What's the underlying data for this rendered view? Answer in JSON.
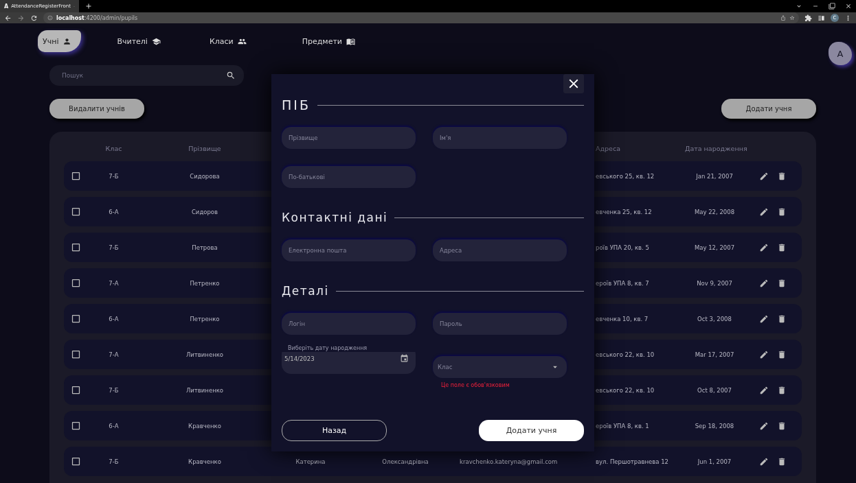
{
  "browser": {
    "tab_icon": "A",
    "tab_title": "AttendanceRegisterFront",
    "url": "**localhost**:4200/admin/pupils",
    "profile": "C"
  },
  "nav": {
    "items": [
      {
        "label": "Учні",
        "selected": true
      },
      {
        "label": "Вчителі",
        "selected": false
      },
      {
        "label": "Класи",
        "selected": false
      },
      {
        "label": "Предмети",
        "selected": false
      }
    ],
    "avatar": "A"
  },
  "search": {
    "placeholder": "Пошук"
  },
  "actions": {
    "delete": "Видалити учнів",
    "add": "Додати учня"
  },
  "table": {
    "columns": [
      "Клас",
      "Прізвище",
      "Адреса",
      "Дата народження"
    ],
    "rows": [
      {
        "checked": false,
        "class": "7-Б",
        "surname": "Сидорова",
        "address": "евського 25, кв. 12",
        "birth_date": "Jan 21, 2007"
      },
      {
        "checked": false,
        "class": "6-А",
        "surname": "Сидоров",
        "address": "евченка 25, кв. 12",
        "birth_date": "May 22, 2008"
      },
      {
        "checked": false,
        "class": "7-Б",
        "surname": "Петрова",
        "address": "роїв УПА 20, кв. 5",
        "birth_date": "May 12, 2007"
      },
      {
        "checked": false,
        "class": "7-А",
        "surname": "Петренко",
        "address": "ероїв УПА 8, кв. 7",
        "birth_date": "Nov 9, 2007"
      },
      {
        "checked": false,
        "class": "6-А",
        "surname": "Петренко",
        "address": "евченка 10, кв. 7",
        "birth_date": "Oct 3, 2008"
      },
      {
        "checked": false,
        "class": "7-А",
        "surname": "Литвиненко",
        "address": "евського 22, кв. 10",
        "birth_date": "Mar 17, 2007"
      },
      {
        "checked": false,
        "class": "7-Б",
        "surname": "Литвиненко",
        "address": "евського 22, кв. 10",
        "birth_date": "Oct 8, 2007"
      },
      {
        "checked": false,
        "class": "6-А",
        "surname": "Кравченко",
        "address": "ероїв УПА 8, кв. 1",
        "birth_date": "Sep 18, 2008"
      },
      {
        "checked": false,
        "class": "7-Б",
        "surname": "Кравченко",
        "name": "Катерина",
        "patronymic": "Олександрівна",
        "email": "kravchenko.kateryna@gmail.com",
        "address": "вул. Першотравнева 12",
        "birth_date": "Jun 1, 2007"
      }
    ]
  },
  "modal": {
    "sections": [
      {
        "title": "ПІБ",
        "fields": [
          {
            "kind": "text",
            "placeholder": "Прізвище"
          },
          {
            "kind": "text",
            "placeholder": "Ім'я"
          },
          {
            "kind": "text",
            "placeholder": "По-батькові"
          }
        ]
      },
      {
        "title": "Контактні дані",
        "fields": [
          {
            "kind": "text",
            "placeholder": "Електронна пошта"
          },
          {
            "kind": "text",
            "placeholder": "Адреса"
          }
        ]
      },
      {
        "title": "Деталі",
        "fields": [
          {
            "kind": "text",
            "placeholder": "Логін"
          },
          {
            "kind": "text",
            "placeholder": "Пароль"
          },
          {
            "kind": "date",
            "label": "Виберіть дату народження",
            "value": "5/14/2023"
          },
          {
            "kind": "select",
            "placeholder": "Клас",
            "error": "Це поле є обов'язковим"
          }
        ]
      }
    ],
    "back": "Назад",
    "submit": "Додати учня"
  }
}
